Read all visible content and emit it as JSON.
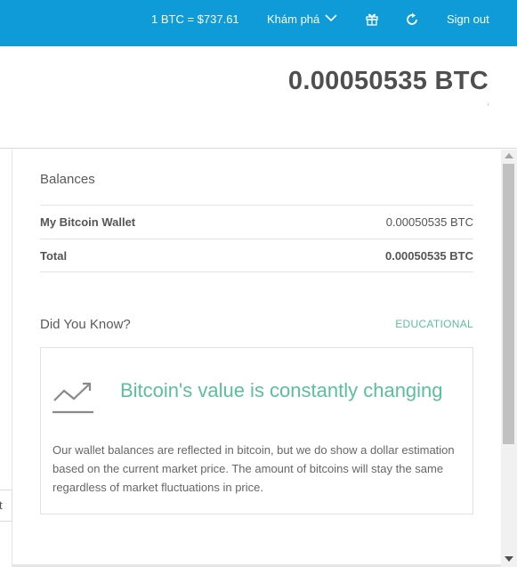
{
  "topbar": {
    "rate_label": "1 BTC =  $737.61",
    "explore_label": "Khám phá",
    "signout_label": "Sign out"
  },
  "balance": {
    "total": "0.00050535 BTC"
  },
  "left_stub": {
    "text": "t"
  },
  "balances": {
    "title": "Balances",
    "rows": [
      {
        "label": "My Bitcoin Wallet",
        "value": "0.00050535 BTC"
      },
      {
        "label": "Total",
        "value": "0.00050535 BTC"
      }
    ]
  },
  "did_you_know": {
    "title": "Did You Know?",
    "category": "EDUCATIONAL",
    "headline": "Bitcoin's value is constantly changing",
    "body": "Our wallet balances are reflected in bitcoin, but we do show a dollar estimation based on the current market price. The amount of bitcoins will stay the same regardless of market fluctuations in price."
  },
  "colors": {
    "topbar": "#0e9bd8",
    "accent_green": "#5cbf9c",
    "text": "#5b5b5b"
  },
  "icons": [
    "chevron-down-icon",
    "gift-icon",
    "refresh-icon",
    "trend-chart-icon"
  ]
}
